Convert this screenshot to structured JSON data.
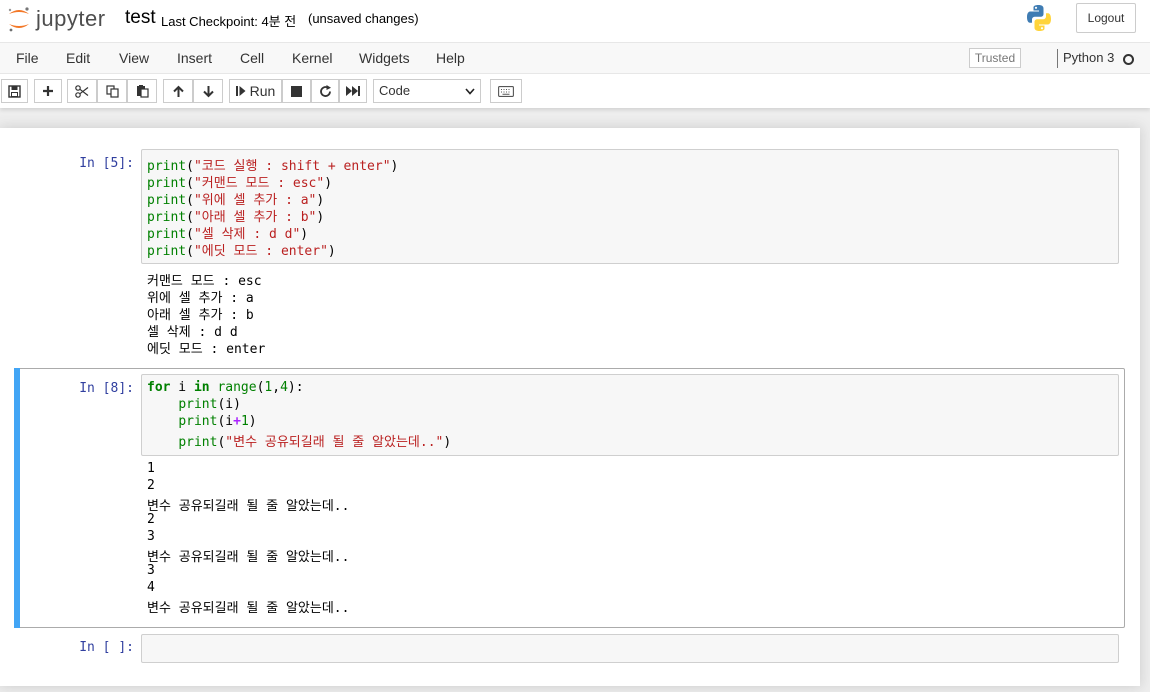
{
  "header": {
    "logo_text": "jupyter",
    "notebook_name": "test",
    "checkpoint": "Last Checkpoint: 4분 전",
    "autosave_status": "(unsaved changes)",
    "logout_label": "Logout"
  },
  "menubar": {
    "items": [
      "File",
      "Edit",
      "View",
      "Insert",
      "Cell",
      "Kernel",
      "Widgets",
      "Help"
    ],
    "trusted_label": "Trusted",
    "kernel_name": "Python 3"
  },
  "toolbar": {
    "buttons": [
      "save-icon",
      "plus-icon",
      "cut-icon",
      "copy-icon",
      "paste-icon",
      "arrow-up-icon",
      "arrow-down-icon",
      "run-icon",
      "stop-icon",
      "restart-icon",
      "fast-forward-icon",
      "keyboard-icon"
    ],
    "run_label": "Run",
    "cell_type": "Code"
  },
  "cells": [
    {
      "prompt": "In [5]:",
      "code": [
        [
          "print",
          "(",
          "\"코드 실행 : shift + enter\"",
          ")"
        ],
        [
          "print",
          "(",
          "\"커맨드 모드 : esc\"",
          ")"
        ],
        [
          "print",
          "(",
          "\"위에 셀 추가 : a\"",
          ")"
        ],
        [
          "print",
          "(",
          "\"아래 셀 추가 : b\"",
          ")"
        ],
        [
          "print",
          "(",
          "\"셀 삭제 : d d\"",
          ")"
        ],
        [
          "print",
          "(",
          "\"에딧 모드 : enter\"",
          ")"
        ]
      ],
      "output": [
        "커맨드 모드 : esc",
        "위에 셀 추가 : a",
        "아래 셀 추가 : b",
        "셀 삭제 : d d",
        "에딧 모드 : enter"
      ]
    },
    {
      "prompt": "In [8]:",
      "code_lines": [
        {
          "kw1": "for",
          "t1": " i ",
          "kw2": "in",
          "t2": " ",
          "fn": "range",
          "t3": "(",
          "n1": "1",
          "t4": ",",
          "n2": "4",
          "t5": "):"
        },
        {
          "indent": "    ",
          "fn": "print",
          "t1": "(i)"
        },
        {
          "indent": "    ",
          "fn": "print",
          "t1": "(i",
          "op": "+",
          "n1": "1",
          "t2": ")"
        },
        {
          "indent": "    ",
          "fn": "print",
          "t1": "(",
          "str": "\"변수 공유되길래 될 줄 알았는데..\"",
          "t2": ")"
        }
      ],
      "output": [
        "1",
        "2",
        "변수 공유되길래 될 줄 알았는데..",
        "2",
        "3",
        "변수 공유되길래 될 줄 알았는데..",
        "3",
        "4",
        "변수 공유되길래 될 줄 알았는데.."
      ]
    },
    {
      "prompt": "In [ ]:"
    }
  ],
  "colors": {
    "prompt": "#303f9f",
    "selected_bar": "#42a5f5",
    "keyword": "#008000",
    "string": "#ba2121",
    "operator": "#aa22ff"
  }
}
